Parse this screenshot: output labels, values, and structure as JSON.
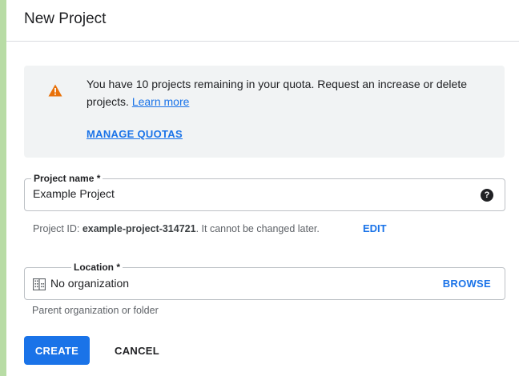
{
  "dialog": {
    "title": "New Project"
  },
  "quota_notice": {
    "icon": "warning-icon",
    "icon_color": "#e8710a",
    "message": "You have 10 projects remaining in your quota. Request an increase or delete projects. ",
    "learn_more": "Learn more",
    "manage_quotas": "MANAGE QUOTAS"
  },
  "project_name": {
    "label": "Project name *",
    "value": "Example Project",
    "help_icon": "help-icon"
  },
  "project_id": {
    "prefix": "Project ID: ",
    "id": "example-project-314721",
    "suffix": ". It cannot be changed later.",
    "edit": "EDIT"
  },
  "location": {
    "label": "Location *",
    "icon": "building-icon",
    "value": "No organization",
    "browse": "BROWSE",
    "helper": "Parent organization or folder"
  },
  "actions": {
    "create": "CREATE",
    "cancel": "CANCEL"
  },
  "colors": {
    "accent": "#1a73e8",
    "background": "#b8dca5"
  }
}
